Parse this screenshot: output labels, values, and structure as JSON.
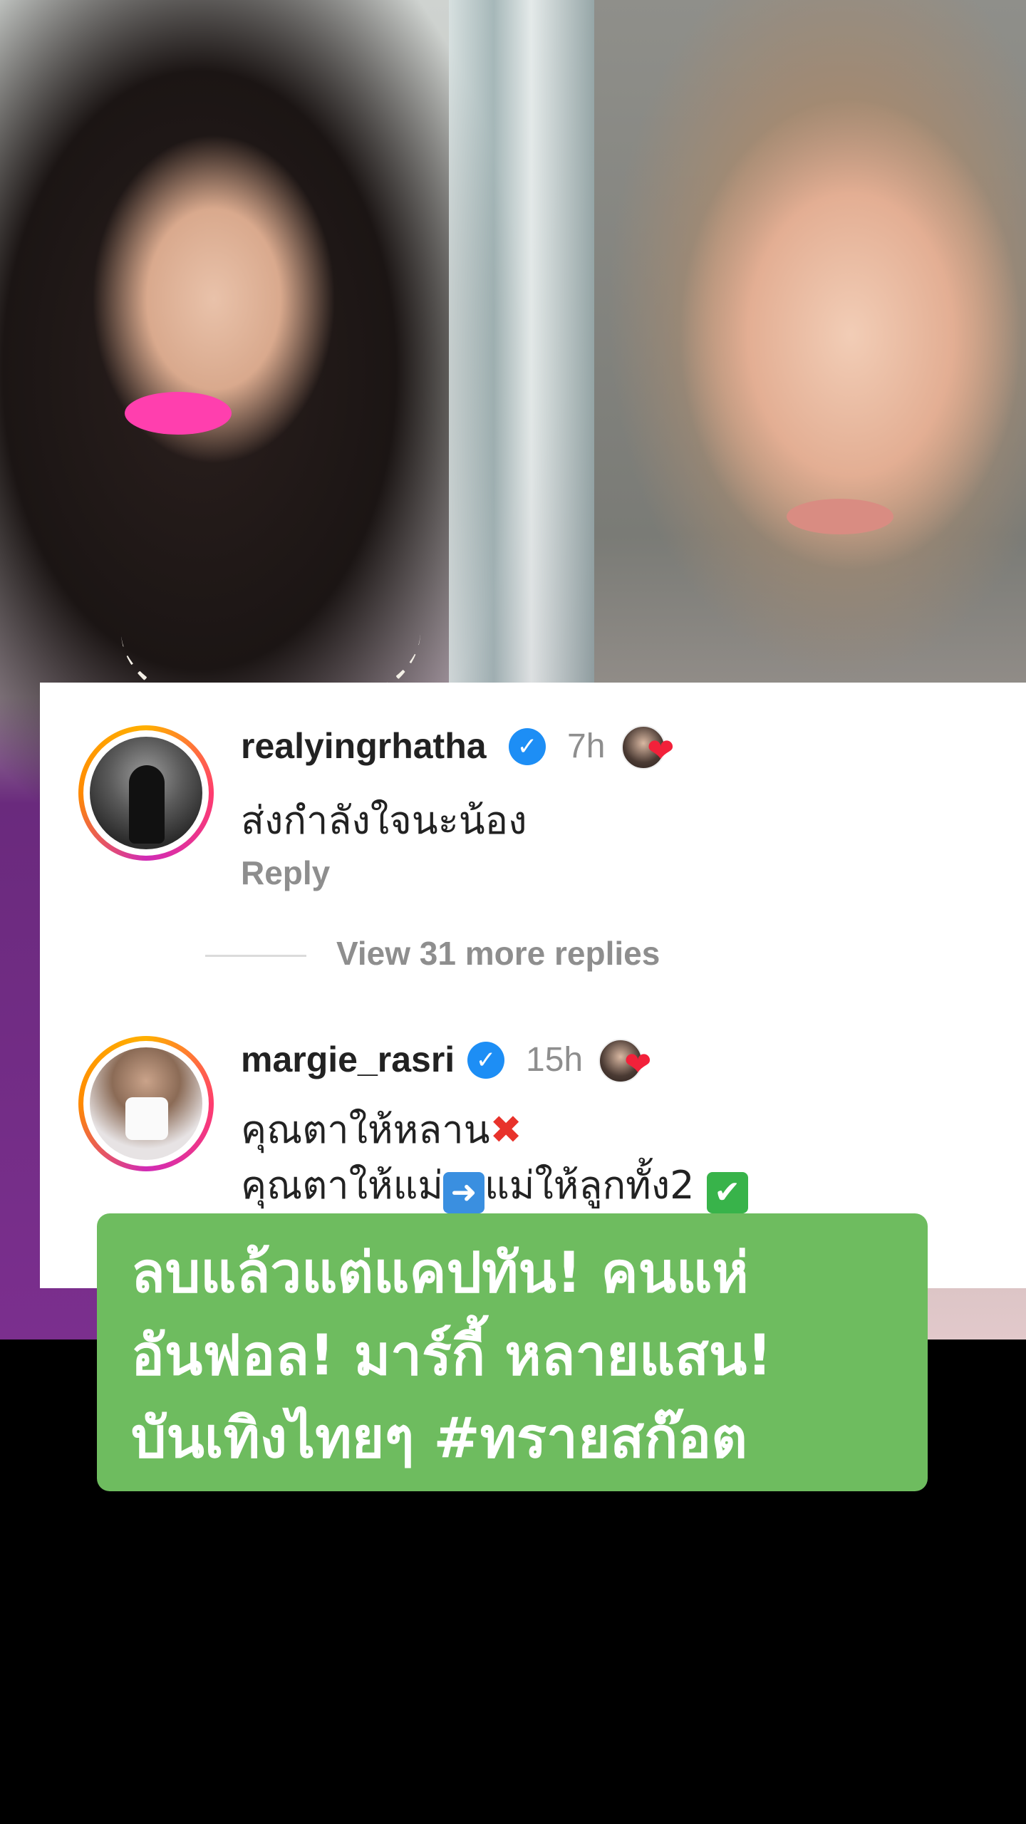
{
  "comments": [
    {
      "username": "realyingrhatha",
      "verified_icon": "verified-badge-icon",
      "time": "7h",
      "text": "ส่งกำลังใจนะน้อง",
      "reply_label": "Reply"
    },
    {
      "username": "margie_rasri",
      "verified_icon": "verified-badge-icon",
      "time": "15h",
      "text_line1": "คุณตาให้หลาน",
      "text_line2_a": "คุณตาให้แม่",
      "text_line2_b": "แม่ให้ลูกทั้ง2"
    }
  ],
  "view_more_replies": "View 31 more replies",
  "caption": {
    "line1": "ลบแล้วแต่แคปทัน! คนแห่",
    "line2": "อันฟอล! มาร์กี้ หลายแสน!",
    "line3": "บันเทิงไทยๆ #ทรายสก๊อต",
    "background": "#6ebc5f"
  },
  "colors": {
    "verified": "#1d8ef5",
    "heart": "#f2213a",
    "secondary_text": "#8e8e8e"
  }
}
